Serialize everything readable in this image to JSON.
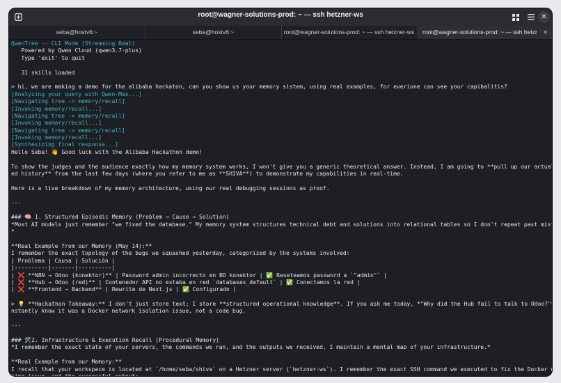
{
  "window": {
    "title": "root@wagner-solutions-prod: ~ — ssh hetzner-ws",
    "title_sub": "···",
    "icons": {
      "new_tab": "new-tab-icon",
      "grid": "grid-icon",
      "menu": "menu-icon",
      "close": "close-icon"
    }
  },
  "tabs": [
    {
      "label": "seba@hostv6:~"
    },
    {
      "label": "seba@hostv6:~"
    },
    {
      "label": "root@wagner-solutions-prod: ~ — ssh hetzner-ws"
    },
    {
      "label": "root@wagner-solutions-prod: ~ — ssh hetzner-ws"
    }
  ],
  "terminal": {
    "lines": [
      {
        "text": "QwenTree -- CLI Mode (Streaming Real)",
        "color": "cyan"
      },
      {
        "text": "   Powered by Qwen Cloud (qwen3.7-plus)",
        "color": "white"
      },
      {
        "text": "   Type 'exit' to quit",
        "color": "white"
      },
      {
        "text": "",
        "color": "white"
      },
      {
        "text": "   31 skills loaded",
        "color": "white"
      },
      {
        "text": "",
        "color": "white"
      },
      {
        "text": "> hi, we are making a demo for the alibaba hackaton, can you show us your memory sistem, using real examples, for everione can see your capibalitis?",
        "color": "white"
      },
      {
        "text": "[Analyzing your query with Qwen-Max...]",
        "color": "cyan"
      },
      {
        "text": "[Navigating tree -> memory/recall]",
        "color": "cyan"
      },
      {
        "text": "[Invoking memory/recall...]",
        "color": "cyan"
      },
      {
        "text": "[Navigating tree -> memory/recall]",
        "color": "cyan"
      },
      {
        "text": "[Invoking memory/recall...]",
        "color": "cyan"
      },
      {
        "text": "[Navigating tree -> memory/recall]",
        "color": "cyan"
      },
      {
        "text": "[Invoking memory/recall...]",
        "color": "cyan"
      },
      {
        "text": "[Synthesizing final response...]",
        "color": "cyan"
      },
      {
        "text": "Hello Seba! 👋 Good luck with the Alibaba Hackathon demo!",
        "color": "white"
      },
      {
        "text": "",
        "color": "white"
      },
      {
        "text": "To show the judges and the audience exactly how my memory system works, I won't give you a generic theoretical answer. Instead, I am going to **pull up our actual shar",
        "color": "white"
      },
      {
        "text": "ed history** from the last few days (where you refer to me as **SHIVA**) to demonstrate my capabilities in real-time.",
        "color": "white"
      },
      {
        "text": "",
        "color": "white"
      },
      {
        "text": "Here is a live breakdown of my memory architecture, using our real debugging sessions as proof.",
        "color": "white"
      },
      {
        "text": "",
        "color": "white"
      },
      {
        "text": "---",
        "color": "white"
      },
      {
        "text": "",
        "color": "white"
      },
      {
        "text": "### 🧠 1. Structured Episodic Memory (Problem → Cause → Solution)",
        "color": "white"
      },
      {
        "text": "*Most AI models just remember \"we fixed the database.\" My memory system structures technical debt and solutions into relational tables so I don't repeat past mistakes.",
        "color": "white"
      },
      {
        "text": "*",
        "color": "white"
      },
      {
        "text": "",
        "color": "white"
      },
      {
        "text": "**Real Example from our Memory (May 14):**",
        "color": "white"
      },
      {
        "text": "I remember the exact topology of the bugs we squashed yesterday, categorized by the systems involved:",
        "color": "white"
      },
      {
        "text": "| Problema | Causa | Solución |",
        "color": "white"
      },
      {
        "text": "|----------|-------|----------|",
        "color": "white"
      },
      {
        "text": "| ❌ **N8N → Odoo (konektor)** | Password admin incorrecto en BD konektor | ✅ Reseteamos password a `\"admin\"` |",
        "color": "white"
      },
      {
        "text": "| ❌ **Hub → Odoo (red)** | Contenedor API no estaba en red `databases_default` | ✅ Conectamos la red |",
        "color": "white"
      },
      {
        "text": "| ❌ **Frontend → Backend** | Rewrite de Next.js | ✅ Configurado |",
        "color": "white"
      },
      {
        "text": "",
        "color": "white"
      },
      {
        "text": "> 💡 **Hackathon Takeaway:** I don't just store text; I store **structured operational knowledge**. If you ask me today, *\"Why did the Hub fail to talk to Odoo?\"*, I i",
        "color": "white"
      },
      {
        "text": "nstantly know it was a Docker network isolation issue, not a code bug.",
        "color": "white"
      },
      {
        "text": "",
        "color": "white"
      },
      {
        "text": "---",
        "color": "white"
      },
      {
        "text": "",
        "color": "white"
      },
      {
        "text": "### 🛠️2. Infrastructure & Execution Recall (Procedural Memory)",
        "color": "white"
      },
      {
        "text": "*I remember the exact state of your servers, the commands we ran, and the outputs we received. I maintain a mental map of your infrastructure.*",
        "color": "white"
      },
      {
        "text": "",
        "color": "white"
      },
      {
        "text": "**Real Example from our Memory:**",
        "color": "white"
      },
      {
        "text": "I recall that your workspace is located at `/home/seba/shiva` on a Hetzner server (`hetzner-ws`). I remember the exact SSH command we executed to fix the Docker networ",
        "color": "white"
      },
      {
        "text": "king issue, and the successful output:",
        "color": "white"
      }
    ]
  }
}
